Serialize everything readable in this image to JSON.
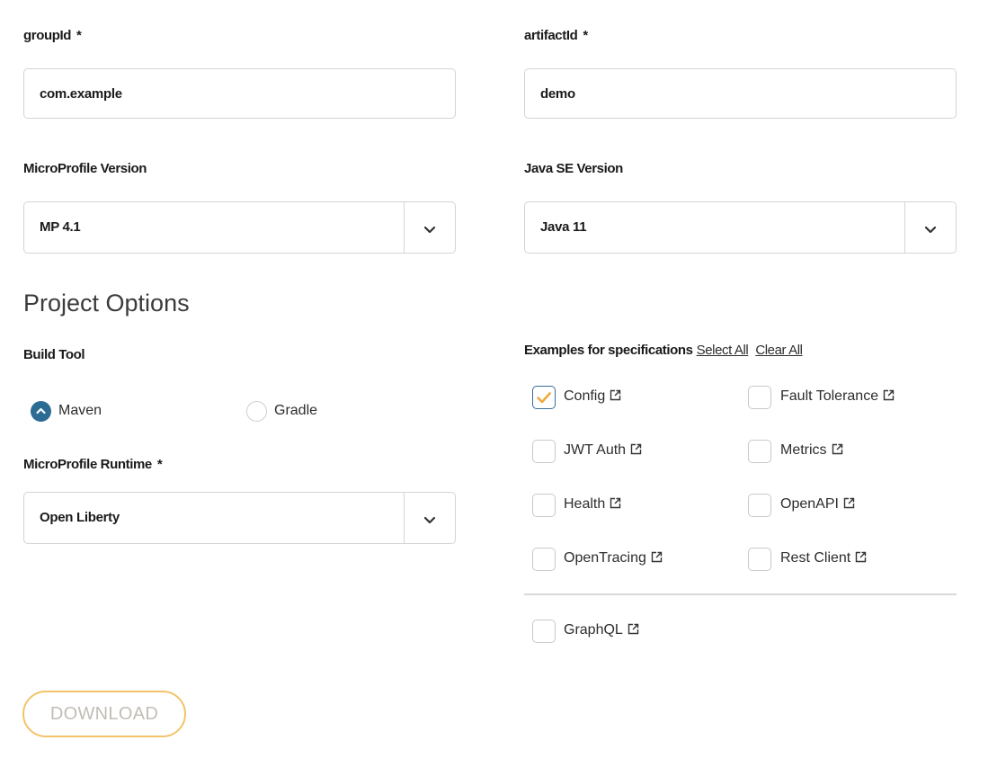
{
  "group_id": {
    "label": "groupId",
    "required_mark": "*",
    "value": "com.example"
  },
  "artifact_id": {
    "label": "artifactId",
    "required_mark": "*",
    "value": "demo"
  },
  "mp_version": {
    "label": "MicroProfile Version",
    "value": "MP 4.1"
  },
  "java_version": {
    "label": "Java SE Version",
    "value": "Java 11"
  },
  "project_options": {
    "title": "Project Options",
    "build_tool": {
      "label": "Build Tool",
      "options": [
        {
          "label": "Maven",
          "selected": true
        },
        {
          "label": "Gradle",
          "selected": false
        }
      ]
    },
    "runtime": {
      "label": "MicroProfile Runtime",
      "required_mark": "*",
      "value": "Open Liberty"
    }
  },
  "examples": {
    "label": "Examples for specifications",
    "select_all": "Select All",
    "clear_all": "Clear All",
    "items": [
      {
        "label": "Config",
        "checked": true
      },
      {
        "label": "Fault Tolerance",
        "checked": false
      },
      {
        "label": "JWT Auth",
        "checked": false
      },
      {
        "label": "Metrics",
        "checked": false
      },
      {
        "label": "Health",
        "checked": false
      },
      {
        "label": "OpenAPI",
        "checked": false
      },
      {
        "label": "OpenTracing",
        "checked": false
      },
      {
        "label": "Rest Client",
        "checked": false
      },
      {
        "label": "GraphQL",
        "checked": false
      }
    ]
  },
  "download_label": "DOWNLOAD",
  "colors": {
    "accent_check": "#f0a93b",
    "radio_on": "#2b6b94",
    "button_border": "#f3c36a"
  }
}
